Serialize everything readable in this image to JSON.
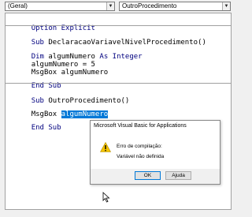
{
  "toolbar": {
    "object_combo": "(Geral)",
    "procedure_combo": "OutroProcedimento"
  },
  "code": {
    "line1": "Option Explicit",
    "line2_kw": "Sub ",
    "line2_rest": "DeclaracaoVariavelNivelProcedimento()",
    "line3_kw1": "Dim ",
    "line3_mid": "algumNumero ",
    "line3_kw2": "As Integer",
    "line4": "algumNumero = 5",
    "line5": "MsgBox algumNumero",
    "line6": "End Sub",
    "line7_kw": "Sub ",
    "line7_rest": "OutroProcedimento()",
    "line8_pre": "MsgBox ",
    "line8_sel": "algumNumero",
    "line9": "End Sub"
  },
  "dialog": {
    "title": "Microsoft Visual Basic for Applications",
    "message1": "Erro de compilação:",
    "message2": "Variável não definida",
    "ok_label": "OK",
    "help_label": "Ajuda",
    "icon": "warning-icon"
  }
}
